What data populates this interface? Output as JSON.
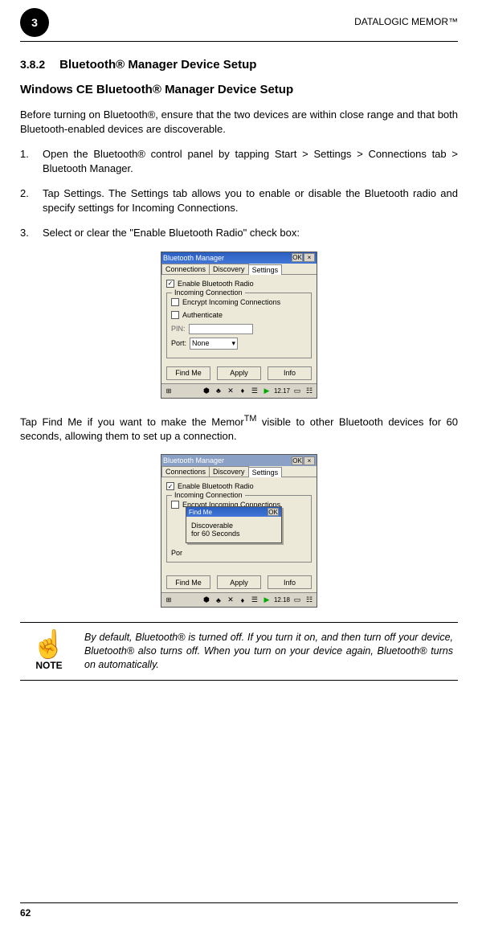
{
  "header": {
    "badge": "3",
    "product": "DATALOGIC MEMOR™"
  },
  "section": {
    "number": "3.8.2",
    "title": "Bluetooth® Manager Device Setup",
    "subtitle": "Windows CE Bluetooth® Manager Device Setup"
  },
  "intro": "Before turning on Bluetooth®, ensure that the two devices are within close range and that both Bluetooth-enabled devices are discoverable.",
  "steps": [
    {
      "num": "1.",
      "text": "Open the Bluetooth® control panel by tapping Start > Settings > Connections tab > Bluetooth Manager."
    },
    {
      "num": "2.",
      "text": "Tap Settings. The Settings tab allows you to enable or disable the Bluetooth radio and specify settings for Incoming Connections."
    },
    {
      "num": "3.",
      "text": "Select or clear the \"Enable Bluetooth Radio\" check box:"
    }
  ],
  "screenshot1": {
    "title": "Bluetooth Manager",
    "ok": "OK",
    "close": "×",
    "tabs": {
      "connections": "Connections",
      "discovery": "Discovery",
      "settings": "Settings"
    },
    "enable_label": "Enable Bluetooth Radio",
    "incoming_legend": "Incoming Connection",
    "encrypt_label": "Encrypt Incoming Connections",
    "auth_label": "Authenticate",
    "pin_label": "PIN:",
    "port_label": "Port:",
    "port_value": "None",
    "buttons": {
      "findme": "Find Me",
      "apply": "Apply",
      "info": "Info"
    },
    "clock": "12.17"
  },
  "mid_para_before": "Tap Find Me if you want to make the Memor",
  "mid_para_tm": "TM",
  "mid_para_after": " visible to other Bluetooth devices for 60 seconds, allowing them to set up a connection.",
  "screenshot2": {
    "title": "Bluetooth Manager",
    "ok": "OK",
    "close": "×",
    "tabs": {
      "connections": "Connections",
      "discovery": "Discovery",
      "settings": "Settings"
    },
    "enable_label": "Enable Bluetooth Radio",
    "incoming_legend": "Incoming Connection",
    "encrypt_partial": "Encrypt Incoming Connections",
    "dialog_title": "Find Me",
    "dialog_ok": "OK",
    "dialog_body_l1": "Discoverable",
    "dialog_body_l2": "for 60 Seconds",
    "port_prefix": "Por",
    "buttons": {
      "findme": "Find Me",
      "apply": "Apply",
      "info": "Info"
    },
    "clock": "12.18"
  },
  "note": {
    "label": "NOTE",
    "text": "By default, Bluetooth® is turned off. If you turn it on, and then turn off your device, Bluetooth® also turns off. When you turn on your device again, Bluetooth® turns on automatically."
  },
  "footer": {
    "page": "62"
  }
}
